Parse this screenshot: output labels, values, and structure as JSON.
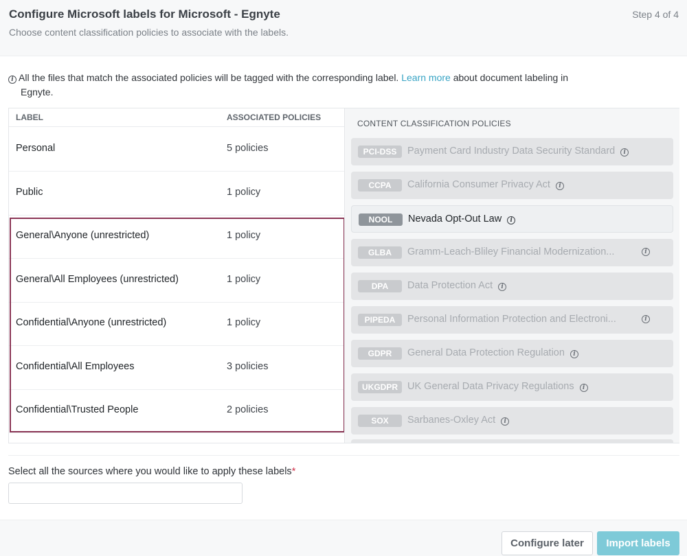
{
  "header": {
    "title": "Configure Microsoft labels for Microsoft - Egnyte",
    "subtitle": "Choose content classification policies to associate with the labels.",
    "step": "Step 4 of 4"
  },
  "info": {
    "text_before": "All the files that match the associated policies will be tagged with the corresponding label.",
    "link": "Learn more",
    "text_after": "about document labeling in",
    "text_cont": "Egnyte."
  },
  "table": {
    "col_label": "LABEL",
    "col_policies": "ASSOCIATED POLICIES",
    "rows": [
      {
        "label": "Personal",
        "policies": "5 policies"
      },
      {
        "label": "Public",
        "policies": "1 policy"
      },
      {
        "label": "General\\Anyone (unrestricted)",
        "policies": "1 policy"
      },
      {
        "label": "General\\All Employees (unrestricted)",
        "policies": "1 policy"
      },
      {
        "label": "Confidential\\Anyone (unrestricted)",
        "policies": "1 policy"
      },
      {
        "label": "Confidential\\All Employees",
        "policies": "3 policies"
      },
      {
        "label": "Confidential\\Trusted People",
        "policies": "2 policies"
      }
    ]
  },
  "policies_panel": {
    "title": "CONTENT CLASSIFICATION POLICIES",
    "items": [
      {
        "code": "PCI-DSS",
        "name": "Payment Card Industry Data Security Standard",
        "active": false
      },
      {
        "code": "CCPA",
        "name": "California Consumer Privacy Act",
        "active": false
      },
      {
        "code": "NOOL",
        "name": "Nevada Opt-Out Law",
        "active": true
      },
      {
        "code": "GLBA",
        "name": "Gramm-Leach-Bliley Financial Modernization...",
        "active": false
      },
      {
        "code": "DPA",
        "name": "Data Protection Act",
        "active": false
      },
      {
        "code": "PIPEDA",
        "name": "Personal Information Protection and Electroni...",
        "active": false
      },
      {
        "code": "GDPR",
        "name": "General Data Protection Regulation",
        "active": false
      },
      {
        "code": "UKGDPR",
        "name": "UK General Data Privacy Regulations",
        "active": false
      },
      {
        "code": "SOX",
        "name": "Sarbanes-Oxley Act",
        "active": false
      }
    ]
  },
  "sources": {
    "label": "Select all the sources where you would like to apply these labels",
    "required_mark": "*",
    "value": ""
  },
  "footer": {
    "configure_later": "Configure later",
    "import_labels": "Import labels"
  },
  "colors": {
    "accent": "#7ecad8",
    "link": "#36a3c4",
    "highlight_border": "#8a3454",
    "required": "#d1344c"
  },
  "icons": {
    "info": "info-circle-icon"
  }
}
